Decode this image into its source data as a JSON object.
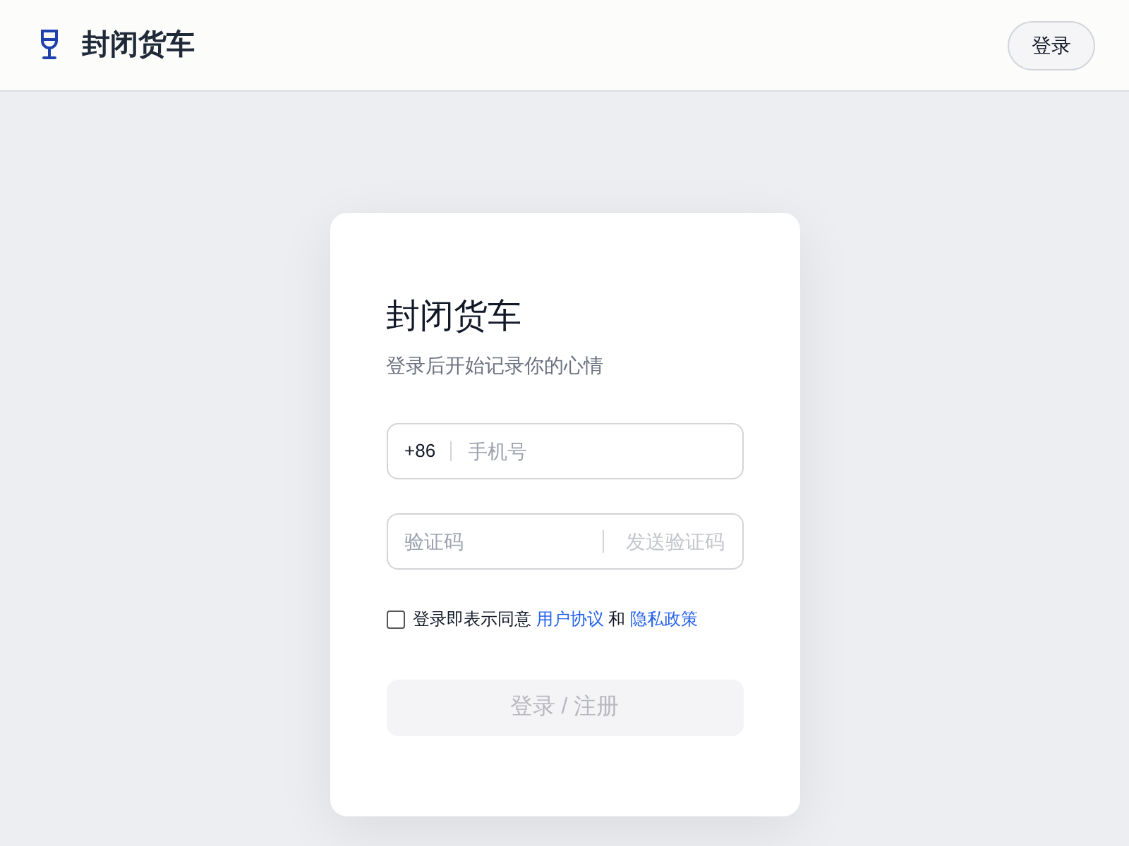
{
  "header": {
    "brand": "封闭货车",
    "login_button": "登录"
  },
  "card": {
    "title": "封闭货车",
    "subtitle": "登录后开始记录你的心情",
    "phone_field": {
      "prefix": "+86",
      "placeholder": "手机号"
    },
    "code_field": {
      "placeholder": "验证码",
      "send_code": {
        "label": "发送验证码",
        "disabled": true
      }
    },
    "agreement": {
      "checked": false,
      "parts": [
        {
          "kind": "text",
          "text": "登录即表示同意"
        },
        {
          "kind": "link",
          "text": "用户协议"
        },
        {
          "kind": "text",
          "text": "和"
        },
        {
          "kind": "link",
          "text": "隐私政策"
        }
      ]
    },
    "submit": {
      "label": "登录 / 注册",
      "disabled": true
    }
  }
}
